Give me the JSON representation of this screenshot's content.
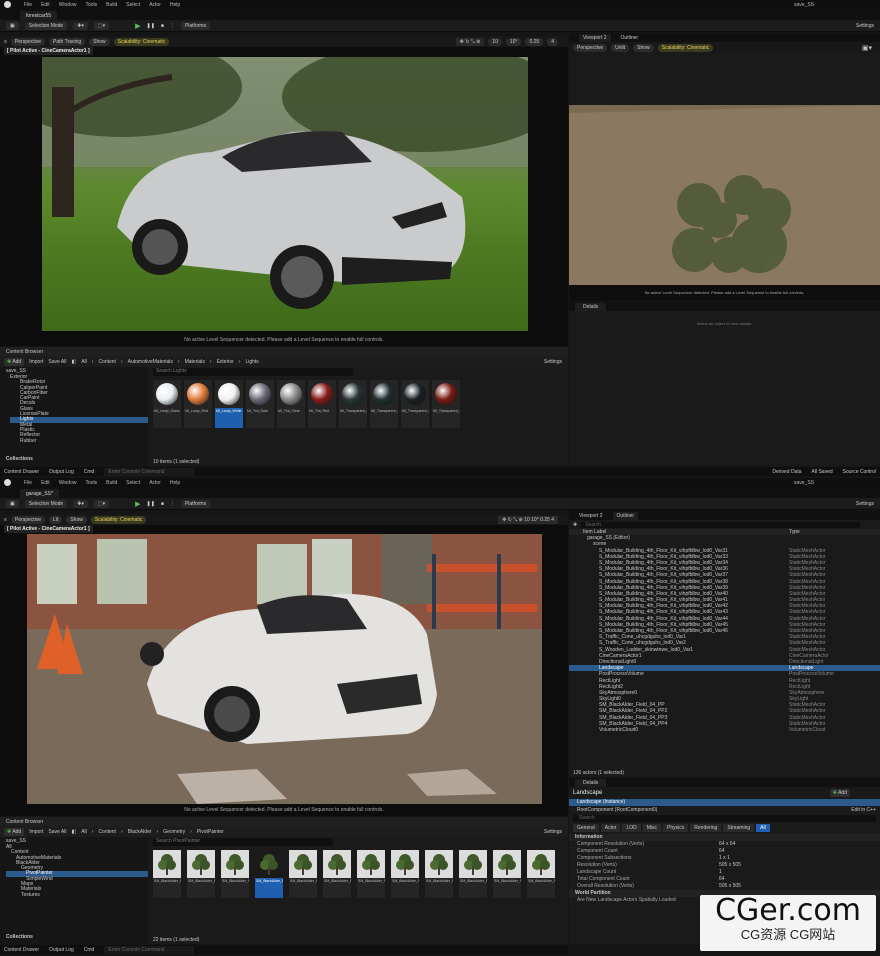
{
  "top": {
    "menu": [
      "File",
      "Edit",
      "Window",
      "Tools",
      "Build",
      "Select",
      "Actor",
      "Help"
    ],
    "project": "save_SS",
    "tab": "forestcar55",
    "toolbar": {
      "mode": "Selection Mode",
      "platforms": "Platforms",
      "settings": "Settings"
    },
    "vp": {
      "perspective": "Perspective",
      "path": "Path Tracing",
      "show": "Show",
      "scal": "Scalability: Cinematic",
      "pilot": "[ Pilot Active - CineCameraActor1 ]",
      "warn": "No active Level Sequencer detected. Please add a Level Sequence to enable full controls.",
      "grid": "10",
      "angle": "10°",
      "scale": "0.25",
      "cam": "4"
    },
    "vp2": {
      "title": "Viewport 2",
      "outliner": "Outliner",
      "perspective": "Perspective",
      "unlit": "Unlit",
      "show": "Show",
      "scal": "Scalability: Cinematic",
      "warn": "No active Level Sequencer detected. Please add a Level Sequence to enable full controls."
    },
    "details": {
      "title": "Details",
      "hint": "Select an object to view details."
    },
    "cb": {
      "title": "Content Browser",
      "add": "Add",
      "import": "Import",
      "save": "Save All",
      "path": [
        "All",
        "Content",
        "AutomotiveMaterials",
        "Materials",
        "Exterior",
        "Lights"
      ],
      "settings": "Settings",
      "search": "Search Lights",
      "root": "save_SS",
      "count": "10 items (1 selected)",
      "collections": "Collections",
      "tree": [
        "Exterior",
        "BrakeRotor",
        "CaliperPaint",
        "CarbonFiber",
        "CarPaint",
        "Decals",
        "Glass",
        "LicensePlate",
        "Lights",
        "Metal",
        "Plastic",
        "Reflector",
        "Rubber"
      ],
      "assets": [
        {
          "name": "MI_Lamp_Glass",
          "color": "#e8eef2"
        },
        {
          "name": "MI_Lamp_Red",
          "color": "#e07a3a"
        },
        {
          "name": "MI_Lamp_White",
          "color": "#f2f2f2"
        },
        {
          "name": "MI_Tint_Dark",
          "color": "#6a6a78"
        },
        {
          "name": "MI_Tint_Clear",
          "color": "#8a8a8a"
        },
        {
          "name": "MI_Tint_Red",
          "color": "#8a1a1a"
        },
        {
          "name": "MI_Transparent_Cover",
          "color": "#2a3638"
        },
        {
          "name": "MI_Transparent_Cover_Tinted",
          "color": "#223034"
        },
        {
          "name": "MI_Transparent_Cover_Dark",
          "color": "#1a2226"
        },
        {
          "name": "MI_Transparent_Cover_Red",
          "color": "#7a1a14"
        }
      ],
      "selectedAsset": 2
    },
    "status": {
      "drawer": "Content Drawer",
      "log": "Output Log",
      "cmd": "Cmd",
      "console": "Enter Console Command",
      "derived": "Derived Data",
      "saved": "All Saved",
      "source": "Source Control"
    }
  },
  "bottom": {
    "menu": [
      "File",
      "Edit",
      "Window",
      "Tools",
      "Build",
      "Select",
      "Actor",
      "Help"
    ],
    "project": "save_SS",
    "tab": "garage_SS*",
    "toolbar": {
      "mode": "Selection Mode",
      "platforms": "Platforms",
      "settings": "Settings"
    },
    "vp": {
      "perspective": "Perspective",
      "lit": "Lit",
      "show": "Show",
      "scal": "Scalability: Cinematic",
      "pilot": "[ Pilot Active - CineCameraActor1 ]",
      "warn": "No active Level Sequencer detected. Please add a Level Sequence to enable full controls."
    },
    "outliner": {
      "vp2": "Viewport 2",
      "title": "Outliner",
      "search": "Search",
      "col1": "Item Label",
      "col2": "Type",
      "world": "garage_SS (Editor)",
      "folder": "scene",
      "count": "136 actors (1 selected)",
      "rows": [
        {
          "n": "S_Modular_Building_4th_Floor_Kit_vihpfblbw_lod0_Var31",
          "t": "StaticMeshActor"
        },
        {
          "n": "S_Modular_Building_4th_Floor_Kit_vihpfblbw_lod0_Var33",
          "t": "StaticMeshActor"
        },
        {
          "n": "S_Modular_Building_4th_Floor_Kit_vihpfblbw_lod0_Var34",
          "t": "StaticMeshActor"
        },
        {
          "n": "S_Modular_Building_4th_Floor_Kit_vihpfblbw_lod0_Var36",
          "t": "StaticMeshActor"
        },
        {
          "n": "S_Modular_Building_4th_Floor_Kit_vihpfblbw_lod0_Var37",
          "t": "StaticMeshActor"
        },
        {
          "n": "S_Modular_Building_4th_Floor_Kit_vihpfblbw_lod0_Var38",
          "t": "StaticMeshActor"
        },
        {
          "n": "S_Modular_Building_4th_Floor_Kit_vihpfblbw_lod0_Var39",
          "t": "StaticMeshActor"
        },
        {
          "n": "S_Modular_Building_4th_Floor_Kit_vihpfblbw_lod0_Var40",
          "t": "StaticMeshActor"
        },
        {
          "n": "S_Modular_Building_4th_Floor_Kit_vihpfblbw_lod0_Var41",
          "t": "StaticMeshActor"
        },
        {
          "n": "S_Modular_Building_4th_Floor_Kit_vihpfblbw_lod0_Var42",
          "t": "StaticMeshActor"
        },
        {
          "n": "S_Modular_Building_4th_Floor_Kit_vihpfblbw_lod0_Var43",
          "t": "StaticMeshActor"
        },
        {
          "n": "S_Modular_Building_4th_Floor_Kit_vihpfblbw_lod0_Var44",
          "t": "StaticMeshActor"
        },
        {
          "n": "S_Modular_Building_4th_Floor_Kit_vihpfblbw_lod0_Var45",
          "t": "StaticMeshActor"
        },
        {
          "n": "S_Modular_Building_4th_Floor_Kit_vihpfblbw_lod0_Var46",
          "t": "StaticMeshActor"
        },
        {
          "n": "S_Traffic_Cone_uhcgdguhs_lod0_Var1",
          "t": "StaticMeshActor"
        },
        {
          "n": "S_Traffic_Cone_uhcgdguhs_lod0_Var2",
          "t": "StaticMeshActor"
        },
        {
          "n": "S_Wooden_Ladder_skinwtnwe_lod0_Var1",
          "t": "StaticMeshActor"
        },
        {
          "n": "CineCameraActor1",
          "t": "CineCameraActor"
        },
        {
          "n": "DirectionalLight0",
          "t": "DirectionalLight"
        },
        {
          "n": "Landscape",
          "t": "Landscape"
        },
        {
          "n": "PostProcessVolume",
          "t": "PostProcessVolume"
        },
        {
          "n": "RectLight",
          "t": "RectLight"
        },
        {
          "n": "RectLight2",
          "t": "RectLight"
        },
        {
          "n": "SkyAtmosphere0",
          "t": "SkyAtmosphere"
        },
        {
          "n": "SkyLight0",
          "t": "SkyLight"
        },
        {
          "n": "SM_BlackAlder_Field_04_PP",
          "t": "StaticMeshActor"
        },
        {
          "n": "SM_BlackAlder_Field_04_PP2",
          "t": "StaticMeshActor"
        },
        {
          "n": "SM_BlackAlder_Field_04_PP3",
          "t": "StaticMeshActor"
        },
        {
          "n": "SM_BlackAlder_Field_04_PP4",
          "t": "StaticMeshActor"
        },
        {
          "n": "VolumetricCloud0",
          "t": "VolumetricCloud"
        }
      ],
      "selectedRow": 19
    },
    "details": {
      "title": "Details",
      "actor": "Landscape",
      "add": "Add",
      "instance": "Landscape (Instance)",
      "root": "RootComponent (RootComponent0)",
      "edit": "Edit in C++",
      "search": "Search",
      "tabs": [
        "General",
        "Actor",
        "LOD",
        "Misc",
        "Physics",
        "Rendering",
        "Streaming",
        "All"
      ],
      "section": "Information",
      "props": [
        {
          "k": "Component Resolution (Verts)",
          "v": "64 x 64"
        },
        {
          "k": "Component Count",
          "v": "64"
        },
        {
          "k": "Component Subsections",
          "v": "1 x 1"
        },
        {
          "k": "Resolution (Verts)",
          "v": "505 x 505"
        },
        {
          "k": "Landscape Count",
          "v": "1"
        },
        {
          "k": "Total Component Count",
          "v": "64"
        },
        {
          "k": "Overall Resolution (Verts)",
          "v": "505 x 505"
        }
      ],
      "section2": "World Partition",
      "wp": "Are New Landscape Actors Spatially Loaded"
    },
    "cb": {
      "title": "Content Browser",
      "add": "Add",
      "import": "Import",
      "save": "Save All",
      "path": [
        "All",
        "Content",
        "BlackAlder",
        "Geometry",
        "PivotPainter"
      ],
      "settings": "Settings",
      "search": "Search PivotPainter",
      "root": "save_SS",
      "count": "22 items (1 selected)",
      "collections": "Collections",
      "tree": [
        "All",
        "Content",
        "AutomotiveMaterials",
        "BlackAlder",
        "Geometry",
        "PivotPainter",
        "SimpleWind",
        "Maps",
        "Materials",
        "Textures"
      ],
      "assets": [
        "SM_BlackAlder_Field_01_PP",
        "SM_BlackAlder_Field_02_PP",
        "SM_BlackAlder_Field_03_PP",
        "SM_BlackAlder_Field_04_PP",
        "SM_BlackAlder_Forest_01_PP",
        "SM_BlackAlder_Forest_02_PP",
        "SM_BlackAlder_Forest_03_PP",
        "SM_BlackAlder_Forest_04_PP",
        "SM_BlackAlder_Forest_05_PP",
        "SM_BlackAlder_Forest_06_PP",
        "SM_BlackAlder_Forest_07_PP",
        "SM_BlackAlder_Forest_08_PP"
      ],
      "selectedAsset": 3
    },
    "status": {
      "drawer": "Content Drawer",
      "log": "Output Log",
      "cmd": "Cmd",
      "console": "Enter Console Command"
    }
  },
  "watermark": {
    "main": "CGer.com",
    "sub": "CG资源 CG网站"
  }
}
